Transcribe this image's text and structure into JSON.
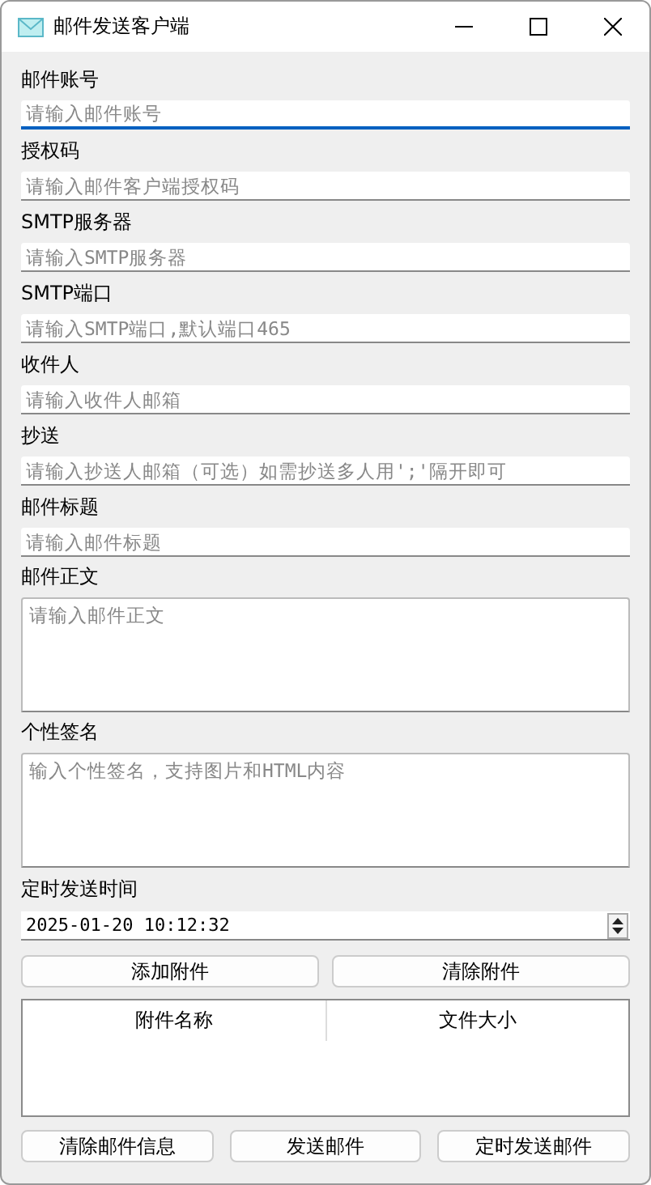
{
  "window": {
    "title": "邮件发送客户端"
  },
  "fields": [
    {
      "label": "邮件账号",
      "placeholder": "请输入邮件账号",
      "kind": "line",
      "focused": true
    },
    {
      "label": "授权码",
      "placeholder": "请输入邮件客户端授权码",
      "kind": "line",
      "focused": false
    },
    {
      "label": "SMTP服务器",
      "placeholder": "请输入SMTP服务器",
      "kind": "line",
      "focused": false
    },
    {
      "label": "SMTP端口",
      "placeholder": "请输入SMTP端口,默认端口465",
      "kind": "line",
      "focused": false
    },
    {
      "label": "收件人",
      "placeholder": "请输入收件人邮箱",
      "kind": "line",
      "focused": false
    },
    {
      "label": "抄送",
      "placeholder": "请输入抄送人邮箱（可选）如需抄送多人用';'隔开即可",
      "kind": "line",
      "focused": false
    },
    {
      "label": "邮件标题",
      "placeholder": "请输入邮件标题",
      "kind": "line",
      "focused": false
    },
    {
      "label": "邮件正文",
      "placeholder": "请输入邮件正文",
      "kind": "area",
      "focused": false
    },
    {
      "label": "个性签名",
      "placeholder": "输入个性签名，支持图片和HTML内容",
      "kind": "area",
      "focused": false
    }
  ],
  "schedule": {
    "label": "定时发送时间",
    "value": "2025-01-20 10:12:32"
  },
  "attachment_buttons": [
    "添加附件",
    "清除附件"
  ],
  "attachments_table": {
    "columns": [
      "附件名称",
      "文件大小"
    ]
  },
  "action_buttons": [
    "清除邮件信息",
    "发送邮件",
    "定时发送邮件"
  ]
}
